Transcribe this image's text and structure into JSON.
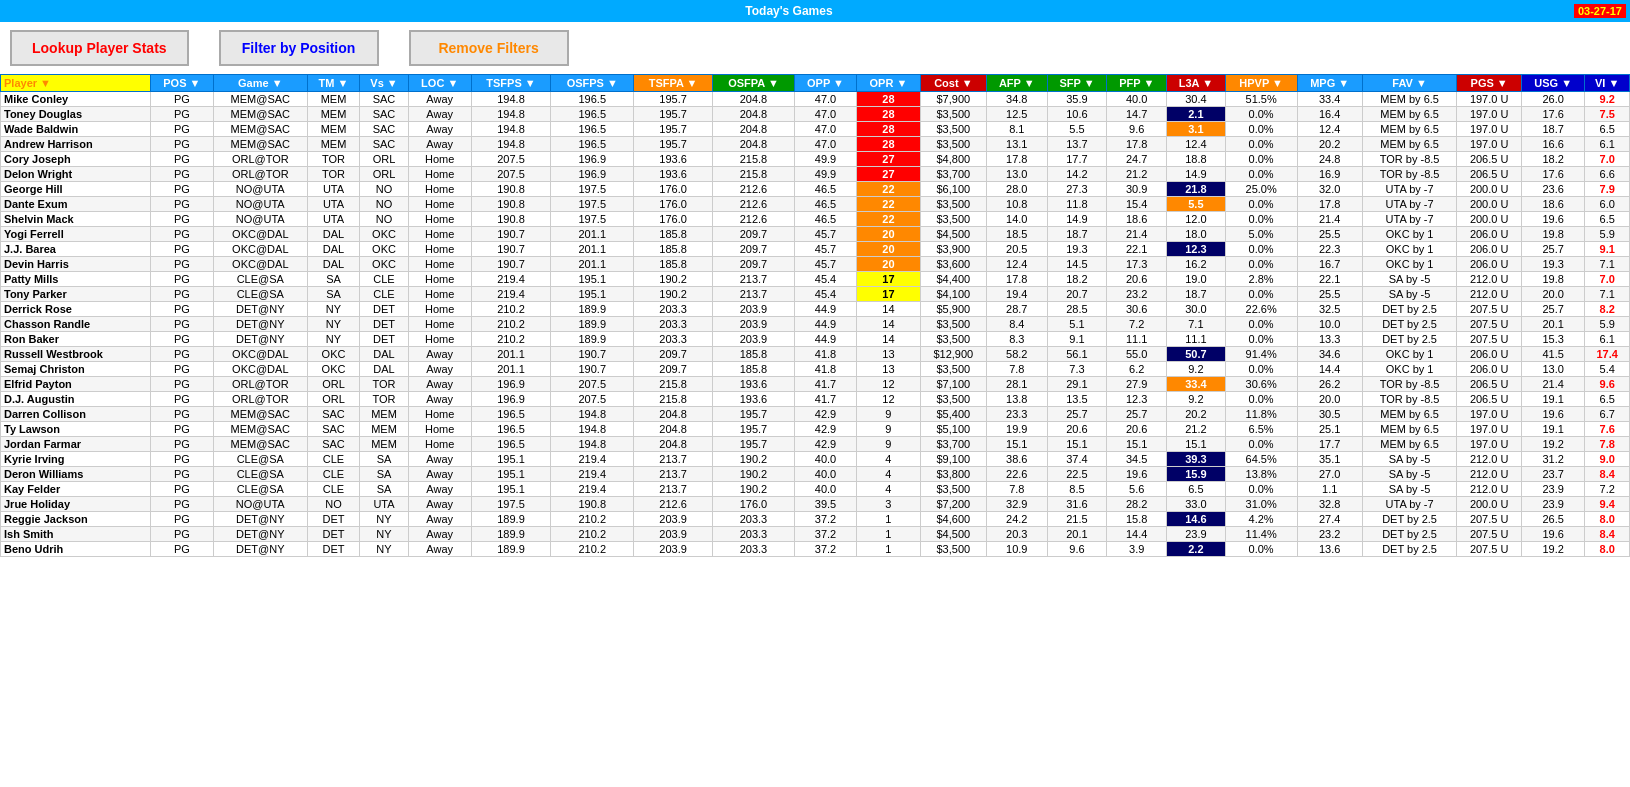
{
  "topbar": {
    "title": "Today's Games",
    "date": "03-27-17"
  },
  "toolbar": {
    "lookup_label": "Lookup Player Stats",
    "filter_label": "Filter by Position",
    "remove_label": "Remove Filters"
  },
  "table": {
    "headers": [
      "Player",
      "POS",
      "Game",
      "TM",
      "Vs",
      "LOC",
      "TSFPS",
      "OSFPS",
      "TSFPA",
      "OSFPA",
      "OPP",
      "OPR",
      "Cost",
      "AFP",
      "SFP",
      "PFP",
      "L3A",
      "HPVP",
      "MPG",
      "FAV",
      "PGS",
      "USG",
      "VI"
    ],
    "rows": [
      [
        "Mike Conley",
        "PG",
        "MEM@SAC",
        "MEM",
        "SAC",
        "Away",
        "194.8",
        "196.5",
        "195.7",
        "204.8",
        "47.0",
        "28",
        "$7,900",
        "34.8",
        "35.9",
        "40.0",
        "30.4",
        "51.5%",
        "33.4",
        "MEM by 6.5",
        "197.0 U",
        "26.0",
        "9.2"
      ],
      [
        "Toney Douglas",
        "PG",
        "MEM@SAC",
        "MEM",
        "SAC",
        "Away",
        "194.8",
        "196.5",
        "195.7",
        "204.8",
        "47.0",
        "28",
        "$3,500",
        "12.5",
        "10.6",
        "14.7",
        "2.1",
        "0.0%",
        "16.4",
        "MEM by 6.5",
        "197.0 U",
        "17.6",
        "7.5"
      ],
      [
        "Wade Baldwin",
        "PG",
        "MEM@SAC",
        "MEM",
        "SAC",
        "Away",
        "194.8",
        "196.5",
        "195.7",
        "204.8",
        "47.0",
        "28",
        "$3,500",
        "8.1",
        "5.5",
        "9.6",
        "3.1",
        "0.0%",
        "12.4",
        "MEM by 6.5",
        "197.0 U",
        "18.7",
        "6.5"
      ],
      [
        "Andrew Harrison",
        "PG",
        "MEM@SAC",
        "MEM",
        "SAC",
        "Away",
        "194.8",
        "196.5",
        "195.7",
        "204.8",
        "47.0",
        "28",
        "$3,500",
        "13.1",
        "13.7",
        "17.8",
        "12.4",
        "0.0%",
        "20.2",
        "MEM by 6.5",
        "197.0 U",
        "16.6",
        "6.1"
      ],
      [
        "Cory Joseph",
        "PG",
        "ORL@TOR",
        "TOR",
        "ORL",
        "Home",
        "207.5",
        "196.9",
        "193.6",
        "215.8",
        "49.9",
        "27",
        "$4,800",
        "17.8",
        "17.7",
        "24.7",
        "18.8",
        "0.0%",
        "24.8",
        "TOR by -8.5",
        "206.5 U",
        "18.2",
        "7.0"
      ],
      [
        "Delon Wright",
        "PG",
        "ORL@TOR",
        "TOR",
        "ORL",
        "Home",
        "207.5",
        "196.9",
        "193.6",
        "215.8",
        "49.9",
        "27",
        "$3,700",
        "13.0",
        "14.2",
        "21.2",
        "14.9",
        "0.0%",
        "16.9",
        "TOR by -8.5",
        "206.5 U",
        "17.6",
        "6.6"
      ],
      [
        "George Hill",
        "PG",
        "NO@UTA",
        "UTA",
        "NO",
        "Home",
        "190.8",
        "197.5",
        "176.0",
        "212.6",
        "46.5",
        "22",
        "$6,100",
        "28.0",
        "27.3",
        "30.9",
        "21.8",
        "25.0%",
        "32.0",
        "UTA by -7",
        "200.0 U",
        "23.6",
        "7.9"
      ],
      [
        "Dante Exum",
        "PG",
        "NO@UTA",
        "UTA",
        "NO",
        "Home",
        "190.8",
        "197.5",
        "176.0",
        "212.6",
        "46.5",
        "22",
        "$3,500",
        "10.8",
        "11.8",
        "15.4",
        "5.5",
        "0.0%",
        "17.8",
        "UTA by -7",
        "200.0 U",
        "18.6",
        "6.0"
      ],
      [
        "Shelvin Mack",
        "PG",
        "NO@UTA",
        "UTA",
        "NO",
        "Home",
        "190.8",
        "197.5",
        "176.0",
        "212.6",
        "46.5",
        "22",
        "$3,500",
        "14.0",
        "14.9",
        "18.6",
        "12.0",
        "0.0%",
        "21.4",
        "UTA by -7",
        "200.0 U",
        "19.6",
        "6.5"
      ],
      [
        "Yogi Ferrell",
        "PG",
        "OKC@DAL",
        "DAL",
        "OKC",
        "Home",
        "190.7",
        "201.1",
        "185.8",
        "209.7",
        "45.7",
        "20",
        "$4,500",
        "18.5",
        "18.7",
        "21.4",
        "18.0",
        "5.0%",
        "25.5",
        "OKC by 1",
        "206.0 U",
        "19.8",
        "5.9"
      ],
      [
        "J.J. Barea",
        "PG",
        "OKC@DAL",
        "DAL",
        "OKC",
        "Home",
        "190.7",
        "201.1",
        "185.8",
        "209.7",
        "45.7",
        "20",
        "$3,900",
        "20.5",
        "19.3",
        "22.1",
        "12.3",
        "0.0%",
        "22.3",
        "OKC by 1",
        "206.0 U",
        "25.7",
        "9.1"
      ],
      [
        "Devin Harris",
        "PG",
        "OKC@DAL",
        "DAL",
        "OKC",
        "Home",
        "190.7",
        "201.1",
        "185.8",
        "209.7",
        "45.7",
        "20",
        "$3,600",
        "12.4",
        "14.5",
        "17.3",
        "16.2",
        "0.0%",
        "16.7",
        "OKC by 1",
        "206.0 U",
        "19.3",
        "7.1"
      ],
      [
        "Patty Mills",
        "PG",
        "CLE@SA",
        "SA",
        "CLE",
        "Home",
        "219.4",
        "195.1",
        "190.2",
        "213.7",
        "45.4",
        "17",
        "$4,400",
        "17.8",
        "18.2",
        "20.6",
        "19.0",
        "2.8%",
        "22.1",
        "SA by -5",
        "212.0 U",
        "19.8",
        "7.0"
      ],
      [
        "Tony Parker",
        "PG",
        "CLE@SA",
        "SA",
        "CLE",
        "Home",
        "219.4",
        "195.1",
        "190.2",
        "213.7",
        "45.4",
        "17",
        "$4,100",
        "19.4",
        "20.7",
        "23.2",
        "18.7",
        "0.0%",
        "25.5",
        "SA by -5",
        "212.0 U",
        "20.0",
        "7.1"
      ],
      [
        "Derrick Rose",
        "PG",
        "DET@NY",
        "NY",
        "DET",
        "Home",
        "210.2",
        "189.9",
        "203.3",
        "203.9",
        "44.9",
        "14",
        "$5,900",
        "28.7",
        "28.5",
        "30.6",
        "30.0",
        "22.6%",
        "32.5",
        "DET by 2.5",
        "207.5 U",
        "25.7",
        "8.2"
      ],
      [
        "Chasson Randle",
        "PG",
        "DET@NY",
        "NY",
        "DET",
        "Home",
        "210.2",
        "189.9",
        "203.3",
        "203.9",
        "44.9",
        "14",
        "$3,500",
        "8.4",
        "5.1",
        "7.2",
        "7.1",
        "0.0%",
        "10.0",
        "DET by 2.5",
        "207.5 U",
        "20.1",
        "5.9"
      ],
      [
        "Ron Baker",
        "PG",
        "DET@NY",
        "NY",
        "DET",
        "Home",
        "210.2",
        "189.9",
        "203.3",
        "203.9",
        "44.9",
        "14",
        "$3,500",
        "8.3",
        "9.1",
        "11.1",
        "11.1",
        "0.0%",
        "13.3",
        "DET by 2.5",
        "207.5 U",
        "15.3",
        "6.1"
      ],
      [
        "Russell Westbrook",
        "PG",
        "OKC@DAL",
        "OKC",
        "DAL",
        "Away",
        "201.1",
        "190.7",
        "209.7",
        "185.8",
        "41.8",
        "13",
        "$12,900",
        "58.2",
        "56.1",
        "55.0",
        "50.7",
        "91.4%",
        "34.6",
        "OKC by 1",
        "206.0 U",
        "41.5",
        "17.4"
      ],
      [
        "Semaj Christon",
        "PG",
        "OKC@DAL",
        "OKC",
        "DAL",
        "Away",
        "201.1",
        "190.7",
        "209.7",
        "185.8",
        "41.8",
        "13",
        "$3,500",
        "7.8",
        "7.3",
        "6.2",
        "9.2",
        "0.0%",
        "14.4",
        "OKC by 1",
        "206.0 U",
        "13.0",
        "5.4"
      ],
      [
        "Elfrid Payton",
        "PG",
        "ORL@TOR",
        "ORL",
        "TOR",
        "Away",
        "196.9",
        "207.5",
        "215.8",
        "193.6",
        "41.7",
        "12",
        "$7,100",
        "28.1",
        "29.1",
        "27.9",
        "33.4",
        "30.6%",
        "26.2",
        "TOR by -8.5",
        "206.5 U",
        "21.4",
        "9.6"
      ],
      [
        "D.J. Augustin",
        "PG",
        "ORL@TOR",
        "ORL",
        "TOR",
        "Away",
        "196.9",
        "207.5",
        "215.8",
        "193.6",
        "41.7",
        "12",
        "$3,500",
        "13.8",
        "13.5",
        "12.3",
        "9.2",
        "0.0%",
        "20.0",
        "TOR by -8.5",
        "206.5 U",
        "19.1",
        "6.5"
      ],
      [
        "Darren Collison",
        "PG",
        "MEM@SAC",
        "SAC",
        "MEM",
        "Home",
        "196.5",
        "194.8",
        "204.8",
        "195.7",
        "42.9",
        "9",
        "$5,400",
        "23.3",
        "25.7",
        "25.7",
        "20.2",
        "11.8%",
        "30.5",
        "MEM by 6.5",
        "197.0 U",
        "19.6",
        "6.7"
      ],
      [
        "Ty Lawson",
        "PG",
        "MEM@SAC",
        "SAC",
        "MEM",
        "Home",
        "196.5",
        "194.8",
        "204.8",
        "195.7",
        "42.9",
        "9",
        "$5,100",
        "19.9",
        "20.6",
        "20.6",
        "21.2",
        "6.5%",
        "25.1",
        "MEM by 6.5",
        "197.0 U",
        "19.1",
        "7.6"
      ],
      [
        "Jordan Farmar",
        "PG",
        "MEM@SAC",
        "SAC",
        "MEM",
        "Home",
        "196.5",
        "194.8",
        "204.8",
        "195.7",
        "42.9",
        "9",
        "$3,700",
        "15.1",
        "15.1",
        "15.1",
        "15.1",
        "0.0%",
        "17.7",
        "MEM by 6.5",
        "197.0 U",
        "19.2",
        "7.8"
      ],
      [
        "Kyrie Irving",
        "PG",
        "CLE@SA",
        "CLE",
        "SA",
        "Away",
        "195.1",
        "219.4",
        "213.7",
        "190.2",
        "40.0",
        "4",
        "$9,100",
        "38.6",
        "37.4",
        "34.5",
        "39.3",
        "64.5%",
        "35.1",
        "SA by -5",
        "212.0 U",
        "31.2",
        "9.0"
      ],
      [
        "Deron Williams",
        "PG",
        "CLE@SA",
        "CLE",
        "SA",
        "Away",
        "195.1",
        "219.4",
        "213.7",
        "190.2",
        "40.0",
        "4",
        "$3,800",
        "22.6",
        "22.5",
        "19.6",
        "15.9",
        "13.8%",
        "27.0",
        "SA by -5",
        "212.0 U",
        "23.7",
        "8.4"
      ],
      [
        "Kay Felder",
        "PG",
        "CLE@SA",
        "CLE",
        "SA",
        "Away",
        "195.1",
        "219.4",
        "213.7",
        "190.2",
        "40.0",
        "4",
        "$3,500",
        "7.8",
        "8.5",
        "5.6",
        "6.5",
        "0.0%",
        "1.1",
        "SA by -5",
        "212.0 U",
        "23.9",
        "7.2"
      ],
      [
        "Jrue Holiday",
        "PG",
        "NO@UTA",
        "NO",
        "UTA",
        "Away",
        "197.5",
        "190.8",
        "212.6",
        "176.0",
        "39.5",
        "3",
        "$7,200",
        "32.9",
        "31.6",
        "28.2",
        "33.0",
        "31.0%",
        "32.8",
        "UTA by -7",
        "200.0 U",
        "23.9",
        "9.4"
      ],
      [
        "Reggie Jackson",
        "PG",
        "DET@NY",
        "DET",
        "NY",
        "Away",
        "189.9",
        "210.2",
        "203.9",
        "203.3",
        "37.2",
        "1",
        "$4,600",
        "24.2",
        "21.5",
        "15.8",
        "14.6",
        "4.2%",
        "27.4",
        "DET by 2.5",
        "207.5 U",
        "26.5",
        "8.0"
      ],
      [
        "Ish Smith",
        "PG",
        "DET@NY",
        "DET",
        "NY",
        "Away",
        "189.9",
        "210.2",
        "203.9",
        "203.3",
        "37.2",
        "1",
        "$4,500",
        "20.3",
        "20.1",
        "14.4",
        "23.9",
        "11.4%",
        "23.2",
        "DET by 2.5",
        "207.5 U",
        "19.6",
        "8.4"
      ],
      [
        "Beno Udrih",
        "PG",
        "DET@NY",
        "DET",
        "NY",
        "Away",
        "189.9",
        "210.2",
        "203.9",
        "203.3",
        "37.2",
        "1",
        "$3,500",
        "10.9",
        "9.6",
        "3.9",
        "2.2",
        "0.0%",
        "13.6",
        "DET by 2.5",
        "207.5 U",
        "19.2",
        "8.0"
      ]
    ],
    "opr_colors": {
      "28": "red",
      "27": "red",
      "22": "orange",
      "20": "orange",
      "17": "yellow",
      "14": "",
      "13": "",
      "12": "",
      "9": "",
      "4": "",
      "3": "",
      "1": ""
    },
    "l3a_highlights": {
      "21.8": "dark-blue",
      "5.5": "orange",
      "12.3": "dark-blue",
      "50.7": "dark-blue",
      "33.4": "orange",
      "15.9": "dark-blue",
      "14.6": "dark-blue",
      "2.2": "dark-blue",
      "2.1": "dark-blue",
      "3.1": "orange",
      "39.3": "dark-blue"
    },
    "pgs_highlights": {
      "26.0": "orange-red",
      "17.6": "red",
      "25.7_barea": "orange",
      "25.7_rose": "orange",
      "41.5": "orange",
      "21.4": "red",
      "31.2": "orange",
      "26.5": "orange"
    },
    "vi_highlights": {}
  }
}
